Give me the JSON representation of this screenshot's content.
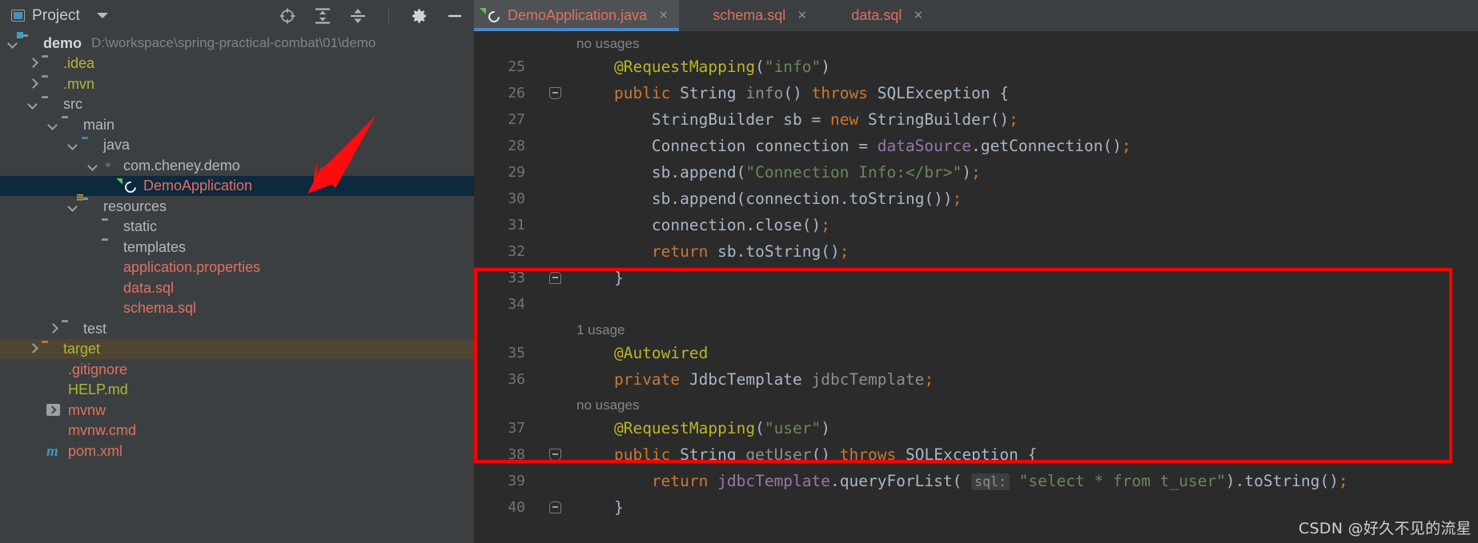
{
  "project_panel": {
    "title": "Project",
    "toolbar_icons": [
      "locate-target-icon",
      "collapse-all-icon",
      "expand-collapse-icon",
      "settings-gear-icon",
      "minimize-icon"
    ],
    "tree": [
      {
        "label": "demo",
        "path": "D:\\workspace\\spring-practical-combat\\01\\demo",
        "indent": 0,
        "arrow": "down",
        "icon": "module-folder-icon",
        "style": "bold",
        "state": "normal"
      },
      {
        "label": ".idea",
        "path": "",
        "indent": 1,
        "arrow": "right",
        "icon": "folder-icon",
        "style": "yellow",
        "state": "normal"
      },
      {
        "label": ".mvn",
        "path": "",
        "indent": 1,
        "arrow": "right",
        "icon": "folder-icon",
        "style": "yellow",
        "state": "normal"
      },
      {
        "label": "src",
        "path": "",
        "indent": 1,
        "arrow": "down",
        "icon": "folder-icon",
        "style": "grey",
        "state": "normal"
      },
      {
        "label": "main",
        "path": "",
        "indent": 2,
        "arrow": "down",
        "icon": "folder-icon",
        "style": "grey",
        "state": "normal"
      },
      {
        "label": "java",
        "path": "",
        "indent": 3,
        "arrow": "down",
        "icon": "source-folder-icon",
        "style": "grey",
        "state": "normal"
      },
      {
        "label": "com.cheney.demo",
        "path": "",
        "indent": 4,
        "arrow": "down",
        "icon": "package-icon",
        "style": "grey",
        "state": "normal"
      },
      {
        "label": "DemoApplication",
        "path": "",
        "indent": 5,
        "arrow": "none",
        "icon": "spring-boot-class-icon",
        "style": "salmon",
        "state": "selected"
      },
      {
        "label": "resources",
        "path": "",
        "indent": 3,
        "arrow": "down",
        "icon": "resources-folder-icon",
        "style": "grey",
        "state": "normal"
      },
      {
        "label": "static",
        "path": "",
        "indent": 4,
        "arrow": "none",
        "icon": "folder-icon",
        "style": "grey",
        "state": "normal"
      },
      {
        "label": "templates",
        "path": "",
        "indent": 4,
        "arrow": "none",
        "icon": "folder-icon",
        "style": "grey",
        "state": "normal"
      },
      {
        "label": "application.properties",
        "path": "",
        "indent": 4,
        "arrow": "none",
        "icon": "properties-file-icon",
        "style": "salmon",
        "state": "normal"
      },
      {
        "label": "data.sql",
        "path": "",
        "indent": 4,
        "arrow": "none",
        "icon": "sql-file-icon",
        "style": "salmon",
        "state": "normal"
      },
      {
        "label": "schema.sql",
        "path": "",
        "indent": 4,
        "arrow": "none",
        "icon": "sql-file-icon",
        "style": "salmon",
        "state": "normal"
      },
      {
        "label": "test",
        "path": "",
        "indent": 2,
        "arrow": "right",
        "icon": "folder-icon",
        "style": "grey",
        "state": "normal"
      },
      {
        "label": "target",
        "path": "",
        "indent": 1,
        "arrow": "right",
        "icon": "excluded-folder-icon",
        "style": "olive",
        "state": "highlight"
      },
      {
        "label": ".gitignore",
        "path": "",
        "indent": 2,
        "arrow": "none",
        "icon": "gitignore-file-icon",
        "style": "salmon",
        "state": "normal"
      },
      {
        "label": "HELP.md",
        "path": "",
        "indent": 2,
        "arrow": "none",
        "icon": "markdown-file-icon",
        "style": "olive",
        "state": "normal"
      },
      {
        "label": "mvnw",
        "path": "",
        "indent": 2,
        "arrow": "none",
        "icon": "script-file-icon",
        "style": "salmon",
        "state": "normal"
      },
      {
        "label": "mvnw.cmd",
        "path": "",
        "indent": 2,
        "arrow": "none",
        "icon": "cmd-file-icon",
        "style": "salmon",
        "state": "normal"
      },
      {
        "label": "pom.xml",
        "path": "",
        "indent": 2,
        "arrow": "none",
        "icon": "maven-file-icon",
        "style": "salmon",
        "state": "normal"
      }
    ]
  },
  "editor": {
    "tabs": [
      {
        "label": "DemoApplication.java",
        "icon": "spring-boot-class-icon",
        "active": true,
        "close": "×"
      },
      {
        "label": "schema.sql",
        "icon": "sql-file-icon",
        "active": false,
        "close": "×"
      },
      {
        "label": "data.sql",
        "icon": "sql-file-icon",
        "active": false,
        "close": "×"
      }
    ],
    "lines": [
      {
        "type": "hint",
        "text": "no usages"
      },
      {
        "type": "code",
        "num": "25",
        "fold": "",
        "tokens": [
          {
            "t": "    ",
            "c": "pln"
          },
          {
            "t": "@RequestMapping",
            "c": "ann"
          },
          {
            "t": "(",
            "c": "punct"
          },
          {
            "t": "\"info\"",
            "c": "str"
          },
          {
            "t": ")",
            "c": "punct"
          }
        ]
      },
      {
        "type": "code",
        "num": "26",
        "fold": "start",
        "tokens": [
          {
            "t": "    ",
            "c": "pln"
          },
          {
            "t": "public",
            "c": "kw"
          },
          {
            "t": " ",
            "c": "pln"
          },
          {
            "t": "String",
            "c": "cls"
          },
          {
            "t": " ",
            "c": "pln"
          },
          {
            "t": "info",
            "c": "dim"
          },
          {
            "t": "()",
            "c": "punct"
          },
          {
            "t": " ",
            "c": "pln"
          },
          {
            "t": "throws",
            "c": "kw"
          },
          {
            "t": " ",
            "c": "pln"
          },
          {
            "t": "SQLException",
            "c": "cls"
          },
          {
            "t": " {",
            "c": "punct"
          }
        ]
      },
      {
        "type": "code",
        "num": "27",
        "fold": "bar",
        "tokens": [
          {
            "t": "        ",
            "c": "pln"
          },
          {
            "t": "StringBuilder",
            "c": "cls"
          },
          {
            "t": " sb ",
            "c": "pln"
          },
          {
            "t": "=",
            "c": "punct"
          },
          {
            "t": " ",
            "c": "pln"
          },
          {
            "t": "new",
            "c": "kw"
          },
          {
            "t": " ",
            "c": "pln"
          },
          {
            "t": "StringBuilder",
            "c": "cls"
          },
          {
            "t": "()",
            "c": "punct"
          },
          {
            "t": ";",
            "c": "semi"
          }
        ]
      },
      {
        "type": "code",
        "num": "28",
        "fold": "bar",
        "tokens": [
          {
            "t": "        ",
            "c": "pln"
          },
          {
            "t": "Connection",
            "c": "cls"
          },
          {
            "t": " connection ",
            "c": "pln"
          },
          {
            "t": "=",
            "c": "punct"
          },
          {
            "t": " ",
            "c": "pln"
          },
          {
            "t": "dataSource",
            "c": "fld"
          },
          {
            "t": ".",
            "c": "punct"
          },
          {
            "t": "getConnection",
            "c": "cls"
          },
          {
            "t": "()",
            "c": "punct"
          },
          {
            "t": ";",
            "c": "semi"
          }
        ]
      },
      {
        "type": "code",
        "num": "29",
        "fold": "bar",
        "tokens": [
          {
            "t": "        ",
            "c": "pln"
          },
          {
            "t": "sb",
            "c": "cls"
          },
          {
            "t": ".",
            "c": "punct"
          },
          {
            "t": "append",
            "c": "cls"
          },
          {
            "t": "(",
            "c": "punct"
          },
          {
            "t": "\"Connection Info:</br>\"",
            "c": "str"
          },
          {
            "t": ")",
            "c": "punct"
          },
          {
            "t": ";",
            "c": "semi"
          }
        ]
      },
      {
        "type": "code",
        "num": "30",
        "fold": "bar",
        "tokens": [
          {
            "t": "        ",
            "c": "pln"
          },
          {
            "t": "sb",
            "c": "cls"
          },
          {
            "t": ".",
            "c": "punct"
          },
          {
            "t": "append",
            "c": "cls"
          },
          {
            "t": "(",
            "c": "punct"
          },
          {
            "t": "connection",
            "c": "cls"
          },
          {
            "t": ".",
            "c": "punct"
          },
          {
            "t": "toString",
            "c": "cls"
          },
          {
            "t": "())",
            "c": "punct"
          },
          {
            "t": ";",
            "c": "semi"
          }
        ]
      },
      {
        "type": "code",
        "num": "31",
        "fold": "bar",
        "tokens": [
          {
            "t": "        ",
            "c": "pln"
          },
          {
            "t": "connection",
            "c": "cls"
          },
          {
            "t": ".",
            "c": "punct"
          },
          {
            "t": "close",
            "c": "cls"
          },
          {
            "t": "()",
            "c": "punct"
          },
          {
            "t": ";",
            "c": "semi"
          }
        ]
      },
      {
        "type": "code",
        "num": "32",
        "fold": "bar",
        "tokens": [
          {
            "t": "        ",
            "c": "pln"
          },
          {
            "t": "return",
            "c": "kw"
          },
          {
            "t": " ",
            "c": "pln"
          },
          {
            "t": "sb",
            "c": "cls"
          },
          {
            "t": ".",
            "c": "punct"
          },
          {
            "t": "toString",
            "c": "cls"
          },
          {
            "t": "()",
            "c": "punct"
          },
          {
            "t": ";",
            "c": "semi"
          }
        ]
      },
      {
        "type": "code",
        "num": "33",
        "fold": "end",
        "tokens": [
          {
            "t": "    ",
            "c": "pln"
          },
          {
            "t": "}",
            "c": "punct"
          }
        ]
      },
      {
        "type": "code",
        "num": "34",
        "fold": "",
        "tokens": []
      },
      {
        "type": "hint",
        "text": "1 usage"
      },
      {
        "type": "code",
        "num": "35",
        "fold": "bar",
        "tokens": [
          {
            "t": "    ",
            "c": "pln"
          },
          {
            "t": "@Autowired",
            "c": "ann"
          }
        ]
      },
      {
        "type": "code",
        "num": "36",
        "fold": "bar",
        "tokens": [
          {
            "t": "    ",
            "c": "pln"
          },
          {
            "t": "private",
            "c": "kw"
          },
          {
            "t": " ",
            "c": "pln"
          },
          {
            "t": "JdbcTemplate",
            "c": "cls"
          },
          {
            "t": " ",
            "c": "pln"
          },
          {
            "t": "jdbcTemplate",
            "c": "dim"
          },
          {
            "t": ";",
            "c": "semi"
          }
        ]
      },
      {
        "type": "hint",
        "text": "no usages"
      },
      {
        "type": "code",
        "num": "37",
        "fold": "bar",
        "tokens": [
          {
            "t": "    ",
            "c": "pln"
          },
          {
            "t": "@RequestMapping",
            "c": "ann"
          },
          {
            "t": "(",
            "c": "punct"
          },
          {
            "t": "\"user\"",
            "c": "str"
          },
          {
            "t": ")",
            "c": "punct"
          }
        ]
      },
      {
        "type": "code",
        "num": "38",
        "fold": "start",
        "tokens": [
          {
            "t": "    ",
            "c": "pln"
          },
          {
            "t": "public",
            "c": "kw"
          },
          {
            "t": " ",
            "c": "pln"
          },
          {
            "t": "String",
            "c": "cls"
          },
          {
            "t": " ",
            "c": "pln"
          },
          {
            "t": "getUser",
            "c": "dim"
          },
          {
            "t": "()",
            "c": "punct"
          },
          {
            "t": " ",
            "c": "pln"
          },
          {
            "t": "throws",
            "c": "kw"
          },
          {
            "t": " ",
            "c": "pln"
          },
          {
            "t": "SQLException",
            "c": "cls"
          },
          {
            "t": " {",
            "c": "punct"
          }
        ]
      },
      {
        "type": "code",
        "num": "39",
        "fold": "bar",
        "tokens": [
          {
            "t": "        ",
            "c": "pln"
          },
          {
            "t": "return",
            "c": "kw"
          },
          {
            "t": " ",
            "c": "pln"
          },
          {
            "t": "jdbcTemplate",
            "c": "fld"
          },
          {
            "t": ".",
            "c": "punct"
          },
          {
            "t": "queryForList",
            "c": "cls"
          },
          {
            "t": "( ",
            "c": "punct"
          },
          {
            "t": "sql:",
            "c": "inlay"
          },
          {
            "t": " ",
            "c": "pln"
          },
          {
            "t": "\"select * from t_user\"",
            "c": "str"
          },
          {
            "t": ")",
            "c": "punct"
          },
          {
            "t": ".",
            "c": "punct"
          },
          {
            "t": "toString",
            "c": "cls"
          },
          {
            "t": "()",
            "c": "punct"
          },
          {
            "t": ";",
            "c": "semi"
          }
        ]
      },
      {
        "type": "code",
        "num": "40",
        "fold": "end",
        "tokens": [
          {
            "t": "    ",
            "c": "pln"
          },
          {
            "t": "}",
            "c": "punct"
          }
        ]
      }
    ]
  },
  "annotations": {
    "red_box_label": "highlight-box",
    "red_arrow_label": "pointer-arrow",
    "accent_red": "#ff0000",
    "accent_blue": "#4a88c7",
    "selection_blue": "#0d293e",
    "target_highlight": "#4e4632"
  },
  "watermark": {
    "text": "CSDN @好久不见的流星"
  }
}
